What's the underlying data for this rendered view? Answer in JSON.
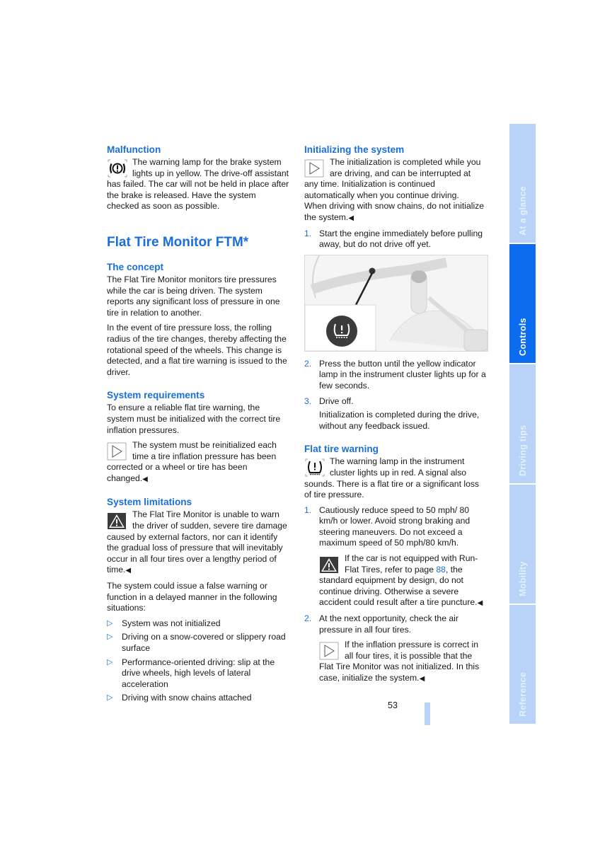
{
  "left": {
    "malfunction": {
      "heading": "Malfunction",
      "text": "The warning lamp for the brake system lights up in yellow. The drive-off assistant has failed. The car will not be held in place after the brake is released. Have the system checked as soon as possible.",
      "icon": "brake-warning-icon"
    },
    "title": "Flat Tire Monitor FTM*",
    "concept": {
      "heading": "The concept",
      "p1": "The Flat Tire Monitor monitors tire pressures while the car is being driven. The system reports any significant loss of pressure in one tire in relation to another.",
      "p2": "In the event of tire pressure loss, the rolling radius of the tire changes, thereby affecting the rotational speed of the wheels. This change is detected, and a flat tire warning is issued to the driver."
    },
    "requirements": {
      "heading": "System requirements",
      "p1": "To ensure a reliable flat tire warning, the system must be initialized with the correct tire inflation pressures.",
      "note": "The system must be reinitialized each time a tire inflation pressure has been corrected or a wheel or tire has been changed.",
      "end": "◀"
    },
    "limitations": {
      "heading": "System limitations",
      "warning": "The Flat Tire Monitor is unable to warn the driver of sudden, severe tire damage caused by external factors, nor can it identify the gradual loss of pressure that will inevitably occur in all four tires over a lengthy period of time.",
      "end": "◀",
      "p1": "The system could issue a false warning or function in a delayed manner in the following situations:",
      "bullet": "▷",
      "items": [
        "System was not initialized",
        "Driving on a snow-covered or slippery road surface",
        "Performance-oriented driving: slip at the drive wheels, high levels of lateral acceleration",
        "Driving with snow chains attached"
      ]
    }
  },
  "right": {
    "init": {
      "heading": "Initializing the system",
      "note": "The initialization is completed while you are driving, and can be interrupted at any time. Initialization is continued automatically when you continue driving.",
      "note2": "When driving with snow chains, do not initialize the system.",
      "end": "◀",
      "steps": [
        {
          "num": "1.",
          "text": "Start the engine immediately before pulling away, but do not drive off yet."
        },
        {
          "num": "2.",
          "text": "Press the button until the yellow indicator lamp in the instrument cluster lights up for a few seconds."
        },
        {
          "num": "3.",
          "text": "Drive off."
        }
      ],
      "step3_detail": "Initialization is completed during the drive, without any feedback issued.",
      "figure_icon": "flat-tire-button-icon"
    },
    "warning": {
      "heading": "Flat tire warning",
      "text": "The warning lamp in the instrument cluster lights up in red. A signal also sounds. There is a flat tire or a significant loss of tire pressure.",
      "steps": [
        {
          "num": "1.",
          "text": "Cautiously reduce speed to 50 mph/ 80 km/h or lower. Avoid strong braking and steering maneuvers. Do not exceed a maximum speed of 50 mph/80 km/h."
        },
        {
          "num": "2.",
          "text": "At the next opportunity, check the air pressure in all four tires."
        }
      ],
      "caution_pre": "If the car is not equipped with Run-Flat Tires, refer to page ",
      "caution_link": "88",
      "caution_post": ", the standard equipment by design, do not continue driving. Otherwise a severe accident could result after a tire puncture.",
      "end": "◀",
      "note": "If the inflation pressure is correct in all four tires, it is possible that the Flat Tire Monitor was not initialized. In this case, initialize the system."
    }
  },
  "tabs": [
    {
      "label": "At a glance",
      "active": false
    },
    {
      "label": "Controls",
      "active": true
    },
    {
      "label": "Driving tips",
      "active": false
    },
    {
      "label": "Mobility",
      "active": false
    },
    {
      "label": "Reference",
      "active": false
    }
  ],
  "page_number": "53",
  "colors": {
    "accent": "#1a6fd8",
    "tab_active": "#0b6cf0",
    "tab_inactive": "#b8d3f7"
  }
}
